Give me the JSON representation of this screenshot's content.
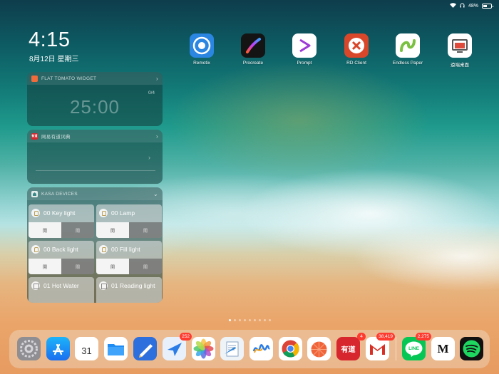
{
  "status_bar": {
    "battery": "48%",
    "battery_level": 0.48
  },
  "clock": {
    "time": "4:15",
    "date": "8月12日 星期三"
  },
  "widgets": {
    "tomato": {
      "title": "FLAT TOMATO WIDGET",
      "counter": "0/4",
      "timer": "25:00"
    },
    "dictionary": {
      "title": "网易有道词典"
    },
    "kasa": {
      "title": "KASA DEVICES",
      "devices": [
        {
          "name": "00 Key light",
          "icon": "bulb-icon",
          "on_label": "開",
          "off_label": "關"
        },
        {
          "name": "00 Lamp",
          "icon": "bulb-icon",
          "on_label": "開",
          "off_label": "關"
        },
        {
          "name": "00 Back light",
          "icon": "bulb-icon",
          "on_label": "開",
          "off_label": "關"
        },
        {
          "name": "00 Fill light",
          "icon": "bulb-icon",
          "on_label": "開",
          "off_label": "關"
        },
        {
          "name": "01 Hot Water",
          "icon": "home-icon"
        },
        {
          "name": "01 Reading light",
          "icon": "home-icon"
        }
      ]
    }
  },
  "home_apps": [
    {
      "label": "Remotix",
      "icon": "remotix-icon",
      "color": "#2a86e0"
    },
    {
      "label": "Procreate",
      "icon": "procreate-icon",
      "color": "#1a1a1a"
    },
    {
      "label": "Prompt",
      "icon": "prompt-icon",
      "color": "#ffffff"
    },
    {
      "label": "RD Client",
      "icon": "rd-client-icon",
      "color": "#d9472b"
    },
    {
      "label": "Endless Paper",
      "icon": "endless-paper-icon",
      "color": "#7ac142"
    },
    {
      "label": "遠端桌面",
      "icon": "remote-desktop-icon",
      "color": "#ffffff"
    }
  ],
  "page_dots": {
    "count": 9,
    "active": 0
  },
  "dock": [
    {
      "name": "settings",
      "icon": "settings-icon"
    },
    {
      "name": "app-store",
      "icon": "app-store-icon"
    },
    {
      "name": "calendar",
      "icon": "calendar-icon",
      "text": "31"
    },
    {
      "name": "files",
      "icon": "files-icon"
    },
    {
      "name": "goodnotes",
      "icon": "goodnotes-icon"
    },
    {
      "name": "spark",
      "icon": "spark-icon",
      "badge": "252"
    },
    {
      "name": "photos",
      "icon": "photos-icon"
    },
    {
      "name": "documents",
      "icon": "documents-icon"
    },
    {
      "name": "freeform",
      "icon": "freeform-icon"
    },
    {
      "name": "chrome",
      "icon": "chrome-icon"
    },
    {
      "name": "flat-tomato",
      "icon": "tomato-icon"
    },
    {
      "name": "youdao",
      "icon": "youdao-icon",
      "text": "有道",
      "badge": "4"
    },
    {
      "name": "gmail",
      "icon": "gmail-icon",
      "text": "M",
      "badge": "38,419"
    },
    {
      "name": "line",
      "icon": "line-icon",
      "text": "LINE",
      "badge": "2,275"
    },
    {
      "name": "medium",
      "icon": "medium-icon",
      "text": "M"
    },
    {
      "name": "spotify",
      "icon": "spotify-icon"
    }
  ]
}
